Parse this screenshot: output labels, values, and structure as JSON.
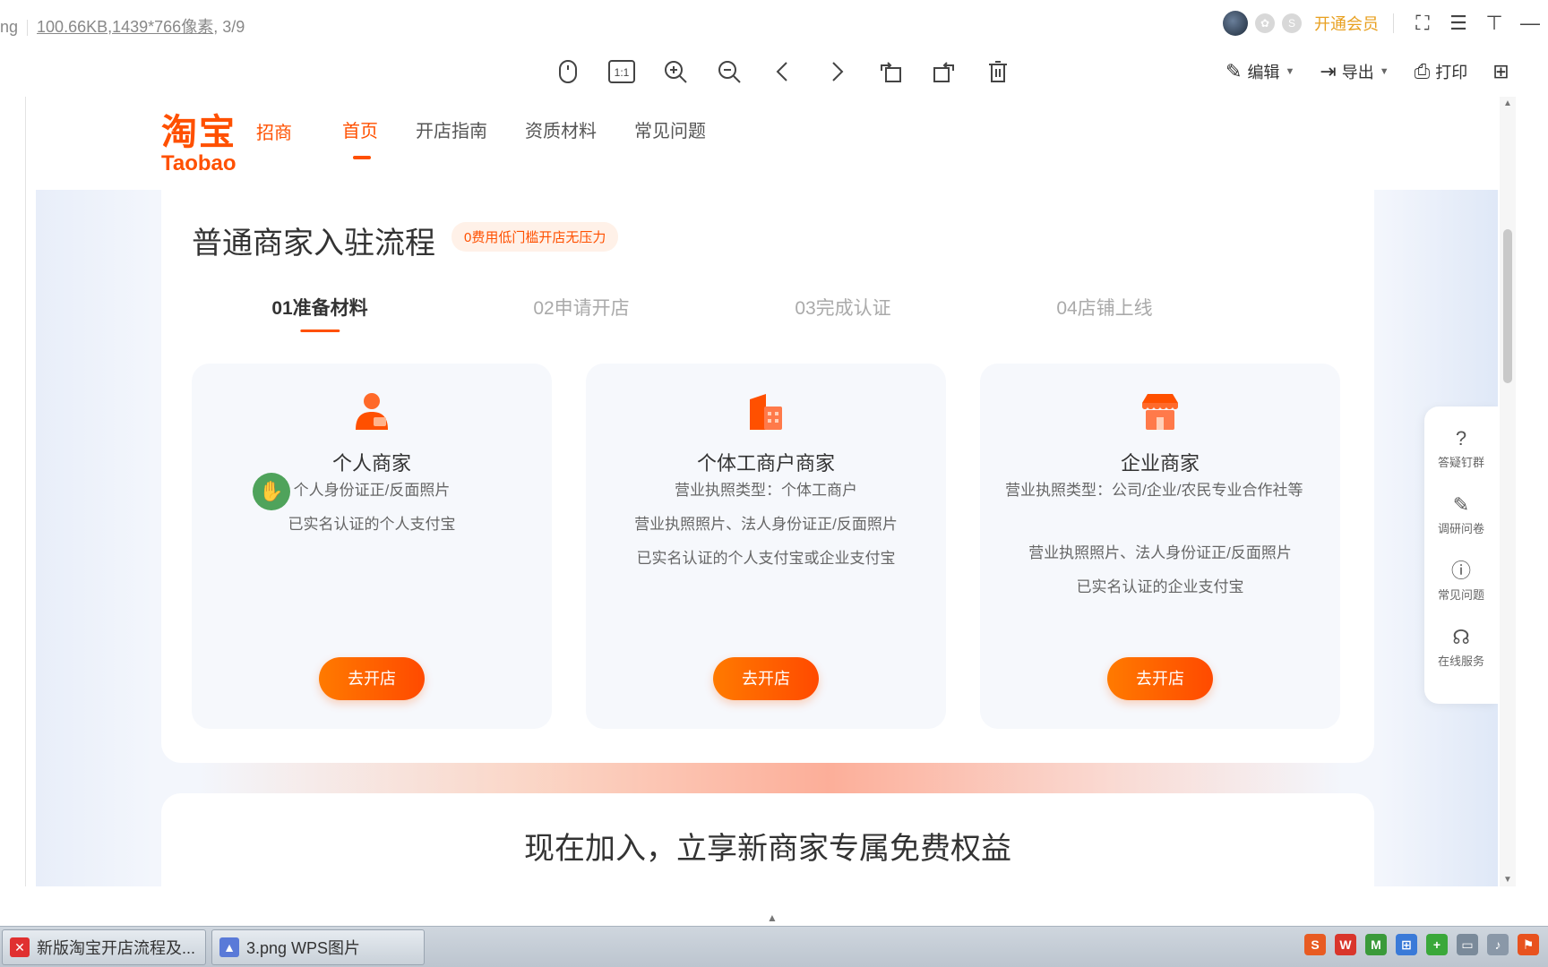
{
  "titlebar": {
    "file_ext_partial": "ng",
    "file_size": "100.66KB",
    "dimensions": ",1439*766像素",
    "page_index": ", 3/9",
    "vip_label": "开通会员"
  },
  "toolbar": {
    "edit_label": "编辑",
    "export_label": "导出",
    "print_label": "打印",
    "one_to_one": "1:1"
  },
  "page": {
    "logo_cn": "淘宝",
    "logo_en": "Taobao",
    "logo_tag": "招商",
    "nav": [
      "首页",
      "开店指南",
      "资质材料",
      "常见问题"
    ],
    "section_title": "普通商家入驻流程",
    "section_badge": "0费用低门槛开店无压力",
    "steps": [
      "01准备材料",
      "02申请开店",
      "03完成认证",
      "04店铺上线"
    ],
    "cards": [
      {
        "title": "个人商家",
        "lines": [
          "个人身份证正/反面照片",
          "已实名认证的个人支付宝"
        ],
        "button": "去开店"
      },
      {
        "title": "个体工商户商家",
        "lines": [
          "营业执照类型：个体工商户",
          "营业执照照片、法人身份证正/反面照片",
          "已实名认证的个人支付宝或企业支付宝"
        ],
        "button": "去开店"
      },
      {
        "title": "企业商家",
        "lines": [
          "营业执照类型：公司/企业/农民专业合作社等",
          "营业执照照片、法人身份证正/反面照片",
          "已实名认证的企业支付宝"
        ],
        "button": "去开店"
      }
    ],
    "join_title": "现在加入，立享新商家专属免费权益",
    "float_bar": [
      {
        "icon": "question-icon",
        "label": "答疑钉群"
      },
      {
        "icon": "pen-icon",
        "label": "调研问卷"
      },
      {
        "icon": "info-icon",
        "label": "常见问题"
      },
      {
        "icon": "headset-icon",
        "label": "在线服务"
      }
    ]
  },
  "taskbar": {
    "tasks": [
      "新版淘宝开店流程及...",
      "3.png   WPS图片"
    ]
  },
  "colors": {
    "brand_orange": "#ff5000",
    "button_gradient_start": "#ff7a00",
    "button_gradient_end": "#ff4a00",
    "vip_gold": "#e8a020"
  }
}
